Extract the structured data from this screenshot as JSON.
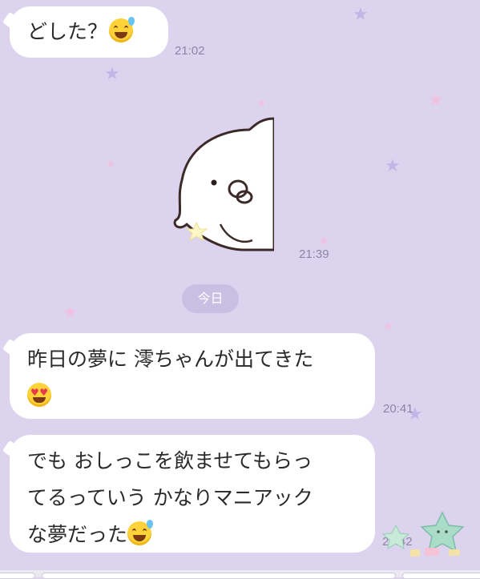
{
  "chat": {
    "messages": [
      {
        "text": "どした？",
        "emoji": "grinning-sweat-emoji",
        "time": "21:02"
      },
      {
        "sticker": "white-bird-sticker",
        "time": "21:39"
      },
      {
        "text_line1": "昨日の夢に 澪ちゃんが出てきた",
        "emoji": "heart-eyes-emoji",
        "time": "20:41"
      },
      {
        "text_line1": "でも おしっこを飲ませてもらっ",
        "text_line2": "てるっていう かなりマニアック",
        "text_line3": "な夢だった",
        "emoji": "grinning-sweat-emoji",
        "time": "20:42"
      }
    ],
    "date_separator": "今日"
  },
  "colors": {
    "background": "#dcd4ef",
    "bubble": "#ffffff",
    "date_pill": "#c8bfe3",
    "star_pink": "#efc2e3",
    "star_lavender": "#c3b6e6",
    "time_text": "#8a86a3"
  }
}
